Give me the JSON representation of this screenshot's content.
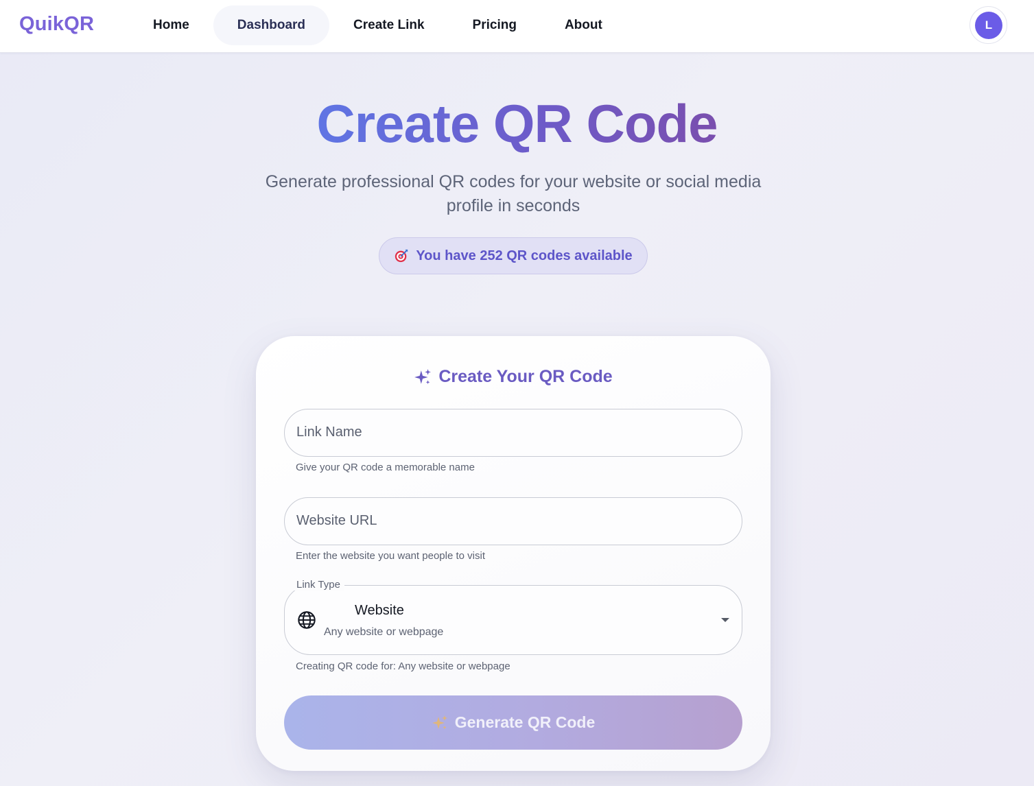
{
  "app": {
    "brand": "QuikQR"
  },
  "nav": {
    "items": [
      {
        "label": "Home",
        "active": false
      },
      {
        "label": "Dashboard",
        "active": true
      },
      {
        "label": "Create Link",
        "active": false
      },
      {
        "label": "Pricing",
        "active": false
      },
      {
        "label": "About",
        "active": false
      }
    ],
    "avatar_initial": "L"
  },
  "hero": {
    "title": "Create QR Code",
    "subtitle": "Generate professional QR codes for your website or social media profile in seconds",
    "quota_text": "You have 252 QR codes available",
    "quota_icon": "target-icon"
  },
  "form": {
    "title": "Create Your QR Code",
    "title_icon": "sparkles-icon",
    "link_name": {
      "placeholder": "Link Name",
      "value": "",
      "helper": "Give your QR code a memorable name"
    },
    "website_url": {
      "placeholder": "Website URL",
      "value": "",
      "helper": "Enter the website you want people to visit"
    },
    "link_type": {
      "label": "Link Type",
      "selected": "Website",
      "selected_description": "Any website or webpage",
      "icon": "globe-icon",
      "helper": "Creating QR code for: Any website or webpage"
    },
    "generate_label": "Generate QR Code",
    "generate_icon": "sparkles-icon"
  },
  "colors": {
    "brand": "#7a63d8",
    "accent": "#6b5ce7",
    "title_gradient_start": "#5f75e4",
    "title_gradient_end": "#7a4fae",
    "button_gradient_start": "#aab4ea",
    "button_gradient_end": "#b6a0cf"
  }
}
